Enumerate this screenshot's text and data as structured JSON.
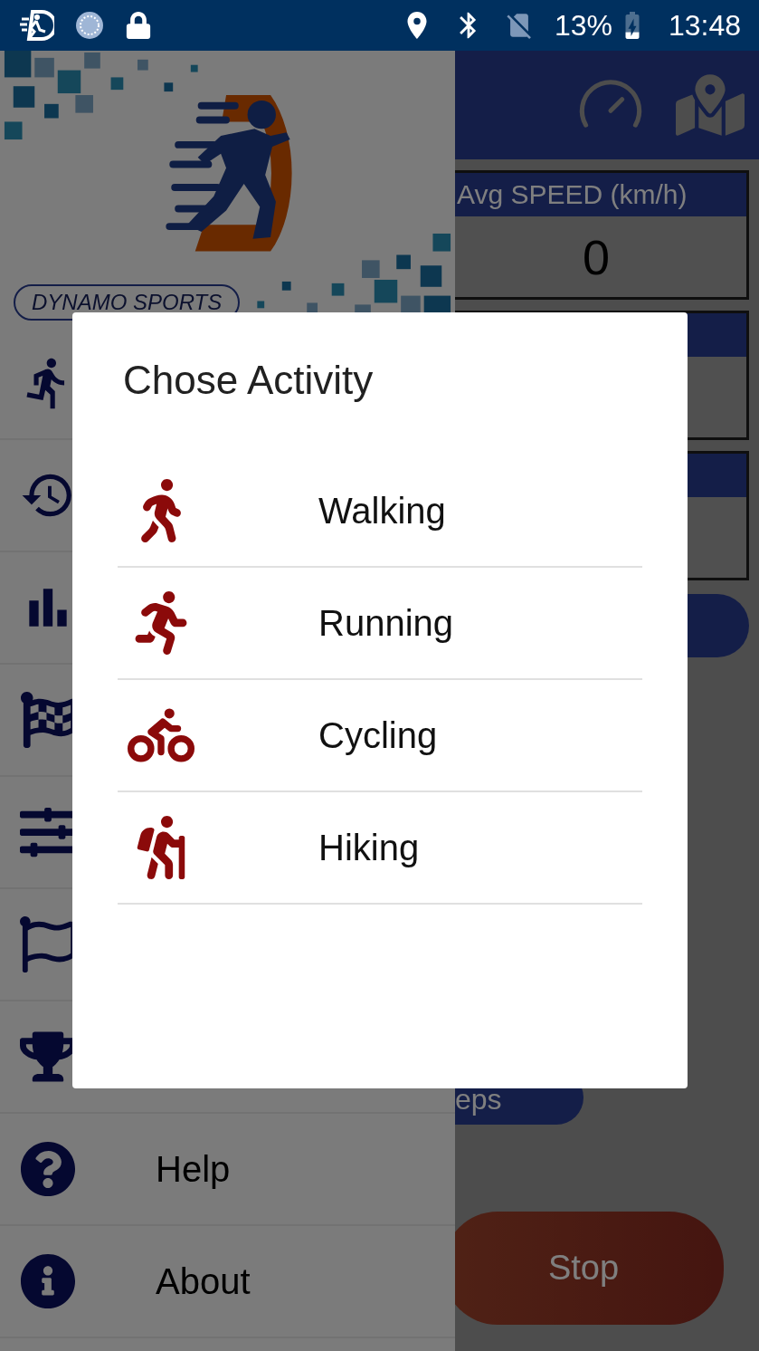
{
  "status_bar": {
    "battery": "13%",
    "time": "13:48"
  },
  "main": {
    "cards": [
      {
        "kind": "stat",
        "title": "Avg SPEED (km/h)",
        "value": "0"
      },
      {
        "kind": "stat"
      },
      {
        "kind": "stat"
      }
    ],
    "buttons": [
      {
        "kind": "pill"
      },
      {
        "kind": "secondary",
        "label": "eps"
      },
      {
        "kind": "stop",
        "label": "Stop"
      }
    ]
  },
  "drawer": {
    "brand": "DYNAMO SPORTS",
    "items": [
      {
        "kind": "running"
      },
      {
        "kind": "history"
      },
      {
        "kind": "stats"
      },
      {
        "kind": "race"
      },
      {
        "kind": "settings"
      },
      {
        "kind": "goal"
      },
      {
        "kind": "trophy"
      },
      {
        "kind": "help",
        "label": "Help"
      },
      {
        "kind": "about",
        "label": "About"
      }
    ]
  },
  "dialog": {
    "title": "Chose Activity",
    "options": [
      {
        "kind": "walking",
        "label": "Walking"
      },
      {
        "kind": "running",
        "label": "Running"
      },
      {
        "kind": "cycling",
        "label": "Cycling"
      },
      {
        "kind": "hiking",
        "label": "Hiking"
      }
    ]
  }
}
